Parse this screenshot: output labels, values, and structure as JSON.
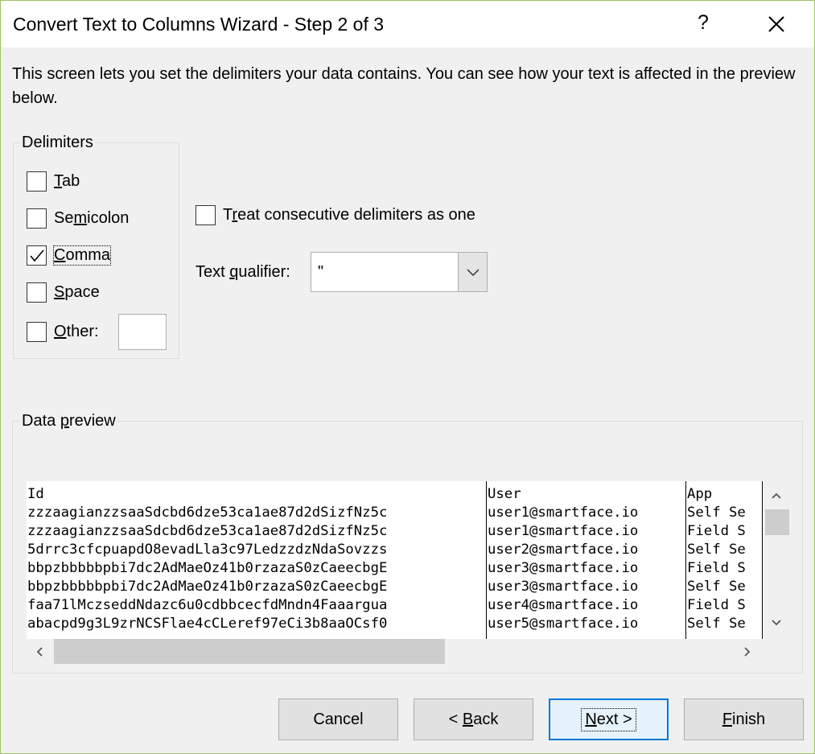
{
  "window": {
    "title": "Convert Text to Columns Wizard - Step 2 of 3",
    "help_label": "?"
  },
  "intro_text": "This screen lets you set the delimiters your data contains.  You can see how your text is affected in the preview below.",
  "delimiters": {
    "legend": "Delimiters",
    "tab": {
      "pre": "",
      "key": "T",
      "post": "ab",
      "checked": false
    },
    "semicolon": {
      "pre": "Se",
      "key": "m",
      "post": "icolon",
      "checked": false
    },
    "comma": {
      "pre": "",
      "key": "C",
      "post": "omma",
      "checked": true
    },
    "space": {
      "pre": "",
      "key": "S",
      "post": "pace",
      "checked": false
    },
    "other": {
      "pre": "",
      "key": "O",
      "post": "ther:",
      "checked": false,
      "value": ""
    }
  },
  "consecutive": {
    "pre": "T",
    "key": "r",
    "post": "eat consecutive delimiters as one",
    "checked": false
  },
  "qualifier": {
    "pre": "Text ",
    "key": "q",
    "post": "ualifier:",
    "selected": "\""
  },
  "preview": {
    "legend_pre": "Data ",
    "legend_key": "p",
    "legend_post": "review",
    "columns": [
      {
        "header": "Id",
        "rows": [
          "zzzaagianzzsaaSdcbd6dze53ca1ae87d2dSizfNz5c",
          "zzzaagianzzsaaSdcbd6dze53ca1ae87d2dSizfNz5c",
          "5drrc3cfcpuapdO8evadLla3c97LedzzdzNdaSovzzs",
          "bbpzbbbbbpbi7dc2AdMaeOz41b0rzazaS0zCaeecbgE",
          "bbpzbbbbbpbi7dc2AdMaeOz41b0rzazaS0zCaeecbgE",
          "faa71lMczseddNdazc6u0cdbbcecfdMndn4Faaargua",
          "abacpd9g3L9zrNCSFlae4cCLeref97eCi3b8aaOCsf0"
        ]
      },
      {
        "header": "User",
        "rows": [
          "user1@smartface.io",
          "user1@smartface.io",
          "user2@smartface.io",
          "user3@smartface.io",
          "user3@smartface.io",
          "user4@smartface.io",
          "user5@smartface.io"
        ]
      },
      {
        "header": "App",
        "rows": [
          "Self Se",
          "Field S",
          "Self Se",
          "Field S",
          "Self Se",
          "Field S",
          "Self Se"
        ]
      }
    ]
  },
  "buttons": {
    "cancel": {
      "pre": "Cancel",
      "key": "",
      "post": ""
    },
    "back": {
      "pre": "< ",
      "key": "B",
      "post": "ack"
    },
    "next": {
      "pre": "",
      "key": "N",
      "post": "ext >"
    },
    "finish": {
      "pre": "",
      "key": "F",
      "post": "inish"
    }
  }
}
